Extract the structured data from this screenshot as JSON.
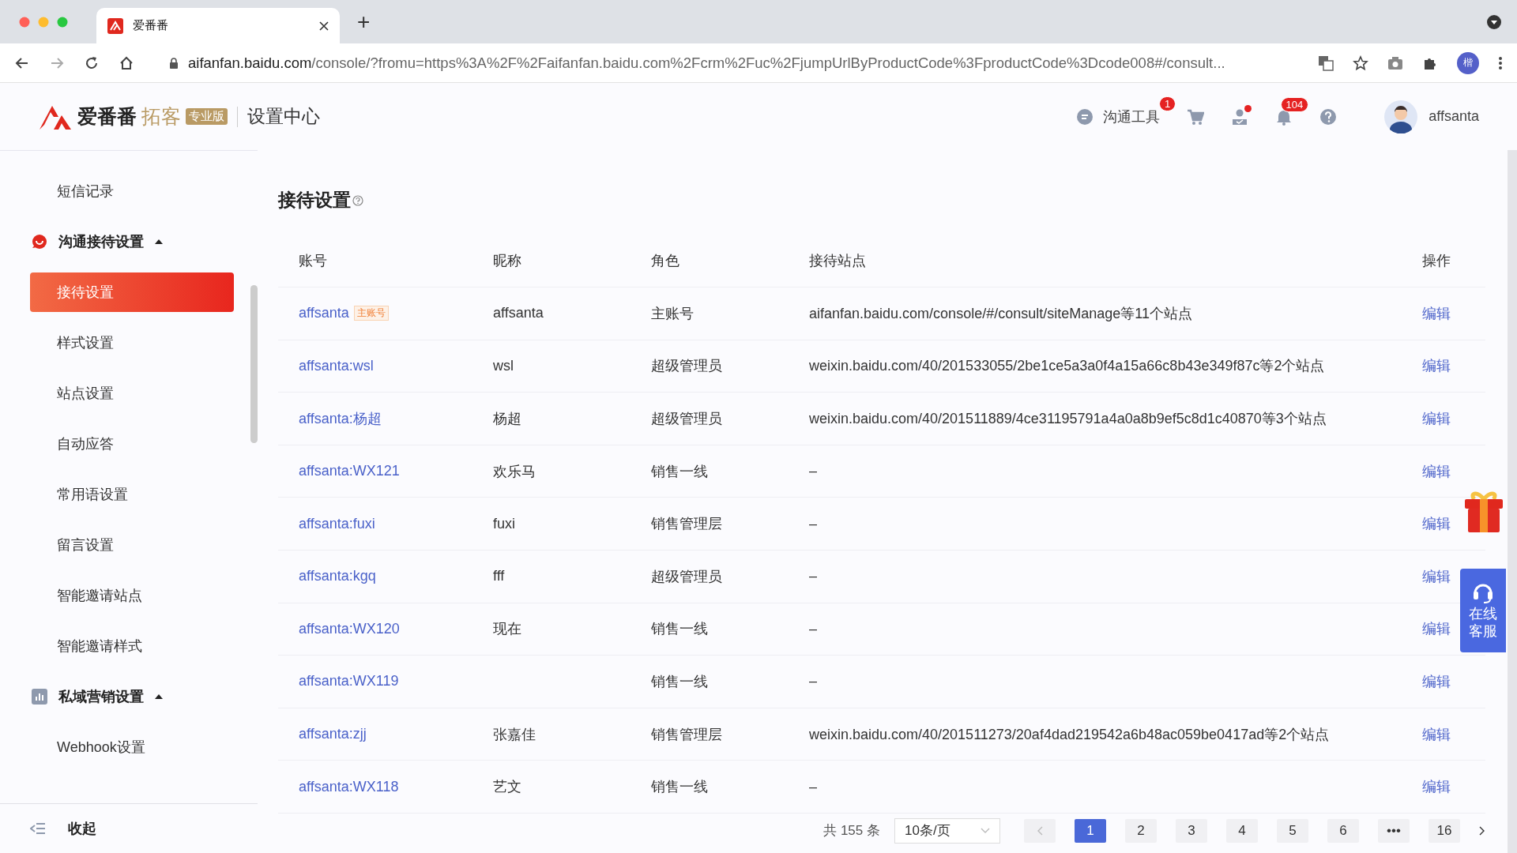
{
  "browser": {
    "tab_title": "爱番番",
    "new_tab": "+",
    "url_host": "aifanfan.baidu.com",
    "url_path": "/console/?fromu=https%3A%2F%2Faifanfan.baidu.com%2Fcrm%2Fuc%2FjumpUrlByProductCode%3FproductCode%3Dcode008#/consult...",
    "profile": "楷"
  },
  "header": {
    "logo": "爱番番",
    "product": "拓客",
    "edition": "专业版",
    "section": "设置中心",
    "user": "affsanta",
    "tools": [
      {
        "kind": "chat",
        "label": "沟通工具",
        "badge": "1"
      },
      {
        "kind": "cart"
      },
      {
        "kind": "contacts",
        "dot": true
      },
      {
        "kind": "bell",
        "badge": "104"
      },
      {
        "kind": "help"
      }
    ]
  },
  "sidebar": {
    "items": [
      {
        "kind": "item",
        "label": "短信记录",
        "selected": false
      },
      {
        "kind": "group",
        "label": "沟通接待设置",
        "expanded": true,
        "children": [
          {
            "label": "接待设置",
            "selected": true
          },
          {
            "label": "样式设置",
            "selected": false
          },
          {
            "label": "站点设置",
            "selected": false
          },
          {
            "label": "自动应答",
            "selected": false
          },
          {
            "label": "常用语设置",
            "selected": false
          },
          {
            "label": "留言设置",
            "selected": false
          },
          {
            "label": "智能邀请站点",
            "selected": false
          },
          {
            "label": "智能邀请样式",
            "selected": false
          }
        ]
      },
      {
        "kind": "group",
        "label": "私域营销设置",
        "expanded": true,
        "children": [
          {
            "label": "Webhook设置",
            "selected": false
          }
        ]
      }
    ],
    "collapse": "收起"
  },
  "page_title": "接待设置",
  "table": {
    "columns": [
      "账号",
      "昵称",
      "角色",
      "接待站点",
      "操作"
    ],
    "rows": [
      {
        "account": "affsanta",
        "tag": "主账号",
        "nickname": "affsanta",
        "role": "主账号",
        "sites": "aifanfan.baidu.com/console/#/consult/siteManage等11个站点",
        "action": "编辑"
      },
      {
        "account": "affsanta:wsl",
        "nickname": "wsl",
        "role": "超级管理员",
        "sites": "weixin.baidu.com/40/201533055/2be1ce5a3a0f4a15a66c8b43e349f87c等2个站点",
        "action": "编辑"
      },
      {
        "account": "affsanta:杨超",
        "nickname": "杨超",
        "role": "超级管理员",
        "sites": "weixin.baidu.com/40/201511889/4ce31195791a4a0a8b9ef5c8d1c40870等3个站点",
        "action": "编辑"
      },
      {
        "account": "affsanta:WX121",
        "nickname": "欢乐马",
        "role": "销售一线",
        "sites": "–",
        "action": "编辑"
      },
      {
        "account": "affsanta:fuxi",
        "nickname": "fuxi",
        "role": "销售管理层",
        "sites": "–",
        "action": "编辑"
      },
      {
        "account": "affsanta:kgq",
        "nickname": "fff",
        "role": "超级管理员",
        "sites": "–",
        "action": "编辑"
      },
      {
        "account": "affsanta:WX120",
        "nickname": "现在",
        "role": "销售一线",
        "sites": "–",
        "action": "编辑"
      },
      {
        "account": "affsanta:WX119",
        "role": "销售一线",
        "sites": "–",
        "action": "编辑"
      },
      {
        "account": "affsanta:zjj",
        "nickname": "张嘉佳",
        "role": "销售管理层",
        "sites": "weixin.baidu.com/40/201511273/20af4dad219542a6b48ac059be0417ad等2个站点",
        "action": "编辑"
      },
      {
        "account": "affsanta:WX118",
        "nickname": "艺文",
        "role": "销售一线",
        "sites": "–",
        "action": "编辑"
      }
    ]
  },
  "pagination": {
    "total": "共 155 条",
    "page_size": "10条/页",
    "pages": [
      {
        "label": "1",
        "selected": true
      },
      {
        "label": "2",
        "selected": false
      },
      {
        "label": "3",
        "selected": false
      },
      {
        "label": "4",
        "selected": false
      },
      {
        "label": "5",
        "selected": false
      },
      {
        "label": "6",
        "selected": false
      },
      {
        "label": "•••",
        "selected": false
      },
      {
        "label": "16",
        "selected": false
      }
    ]
  },
  "service": {
    "label": "在线客服"
  }
}
